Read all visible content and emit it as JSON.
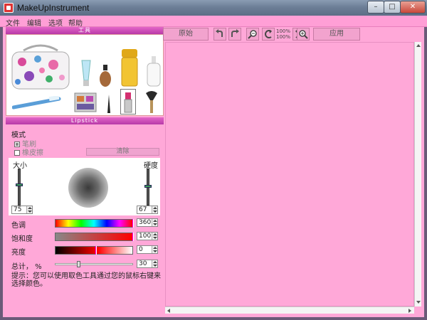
{
  "window": {
    "title": "MakeUpInstrument"
  },
  "menu": [
    "文件",
    "编辑",
    "选项",
    "帮助"
  ],
  "tools_panel": {
    "header": "工具",
    "tools": [
      "cosmetic-bag",
      "foundation-tube",
      "foundation-bottle",
      "cream-jar",
      "lotion-bottle",
      "toothbrush",
      "eyeshadow-palette",
      "eyeliner",
      "lipstick",
      "powder-brush"
    ],
    "selected_tool": "lipstick"
  },
  "lipstick_panel": {
    "header": "Lipstick",
    "mode_label": "模式",
    "mode_options": [
      {
        "label": "笔刷",
        "checked": true
      },
      {
        "label": "橡皮擦",
        "checked": false
      }
    ],
    "clear_label": "清除",
    "size_label": "大小",
    "hardness_label": "硬度",
    "size_value": "75",
    "hardness_value": "67",
    "hue_label": "色调",
    "hue_value": "360",
    "saturation_label": "饱和度",
    "saturation_value": "100",
    "brightness_label": "亮度",
    "brightness_value": "0",
    "total_label": "总计， %",
    "total_value": "30",
    "tip": "提示：您可以使用取色工具通过您的鼠标右键来选择颜色。"
  },
  "toolbar": {
    "original_label": "原始",
    "zoom_top": "100%",
    "zoom_bottom": "100%",
    "apply_label": "应用"
  },
  "colors": {
    "panel_bg": "#ffa8d8",
    "header_accent": "#c847b4",
    "title_bar": "#6d7f97"
  }
}
